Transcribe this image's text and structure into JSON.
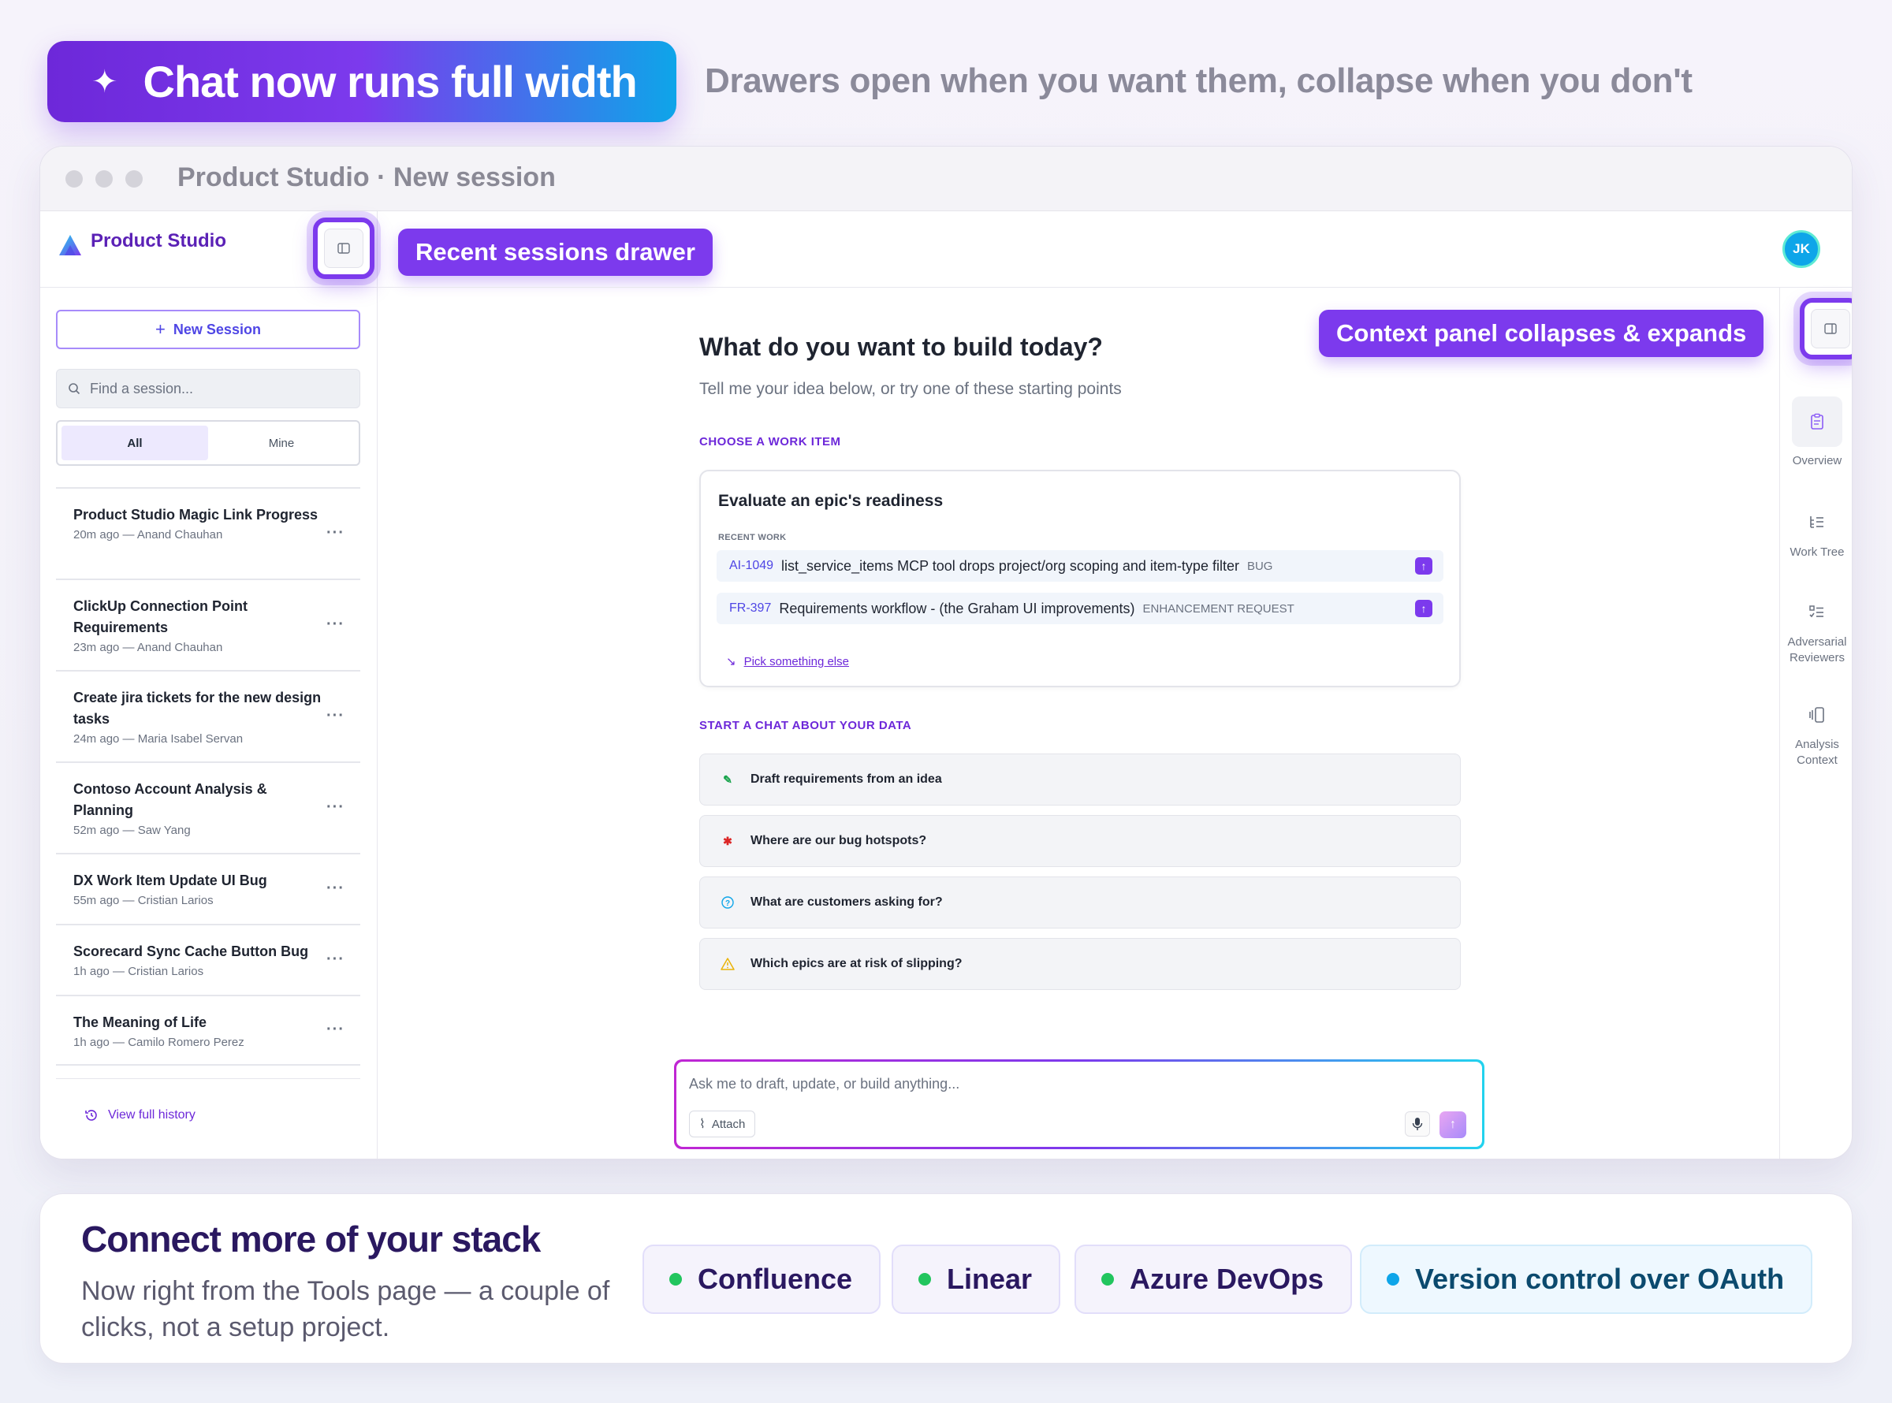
{
  "hero": {
    "badge_icon": "sparkle-icon",
    "title": "Chat now runs full width",
    "subtitle": "Drawers open when you want them, collapse when you don't"
  },
  "window": {
    "title": "Product Studio · New session"
  },
  "sidebar": {
    "brand": "Product Studio",
    "new_session": "New Session",
    "search_placeholder": "Find a session...",
    "filters": [
      "All",
      "Mine"
    ],
    "sessions": [
      {
        "title": "Product Studio Magic Link Progress",
        "meta": "20m ago — Anand Chauhan"
      },
      {
        "title": "ClickUp Connection Point Requirements",
        "meta": "23m ago — Anand Chauhan"
      },
      {
        "title": "Create jira tickets for the new design tasks",
        "meta": "24m ago — Maria Isabel Servan"
      },
      {
        "title": "Contoso Account Analysis & Planning",
        "meta": "52m ago — Saw Yang"
      },
      {
        "title": "DX Work Item Update UI Bug",
        "meta": "55m ago — Cristian Larios"
      },
      {
        "title": "Scorecard Sync Cache Button Bug",
        "meta": "1h ago — Cristian Larios"
      },
      {
        "title": "The Meaning of Life",
        "meta": "1h ago — Camilo Romero Perez"
      }
    ],
    "more_label": "···",
    "history": "View full history"
  },
  "callouts": {
    "sessions": "Recent sessions drawer",
    "context": "Context panel collapses & expands"
  },
  "user": {
    "initials": "JK"
  },
  "main": {
    "heading": "What do you want to build today?",
    "subheading": "Tell me your idea below, or try one of these starting points",
    "work_eyebrow": "CHOOSE A WORK ITEM",
    "card_title": "Evaluate an epic's readiness",
    "recent_label": "RECENT WORK",
    "work_items": [
      {
        "id": "AI-1049",
        "title": "list_service_items MCP tool drops project/org scoping and item-type filter",
        "type": "BUG"
      },
      {
        "id": "FR-397",
        "title": "Requirements workflow - (the Graham UI improvements)",
        "type": "ENHANCEMENT REQUEST"
      }
    ],
    "pick_else": "Pick something else",
    "chat_eyebrow": "START A CHAT ABOUT YOUR DATA",
    "prompts": [
      {
        "label": "Draft requirements from an idea",
        "icon": "pencil-icon"
      },
      {
        "label": "Where are our bug hotspots?",
        "icon": "bug-icon"
      },
      {
        "label": "What are customers asking for?",
        "icon": "question-icon"
      },
      {
        "label": "Which epics are at risk of slipping?",
        "icon": "warning-icon"
      }
    ],
    "composer_placeholder": "Ask me to draft, update, or build anything...",
    "attach": "Attach"
  },
  "rail": {
    "items": [
      {
        "label": "Overview",
        "icon": "clipboard-icon"
      },
      {
        "label": "Work Tree",
        "icon": "tree-list-icon"
      },
      {
        "label": "Adversarial Reviewers",
        "icon": "checklist-icon"
      },
      {
        "label": "Analysis Context",
        "icon": "panel-stack-icon"
      }
    ]
  },
  "stack": {
    "title": "Connect more of your stack",
    "subtitle": "Now right from the Tools page — a couple of clicks, not a setup project.",
    "chips": [
      {
        "label": "Confluence",
        "color": "#22c55e"
      },
      {
        "label": "Linear",
        "color": "#22c55e"
      },
      {
        "label": "Azure DevOps",
        "color": "#22c55e"
      },
      {
        "label": "Version control over OAuth",
        "color": "#0ea5e9"
      }
    ]
  },
  "colors": {
    "accent": "#7c3aed",
    "cyan": "#0ea5e9"
  }
}
